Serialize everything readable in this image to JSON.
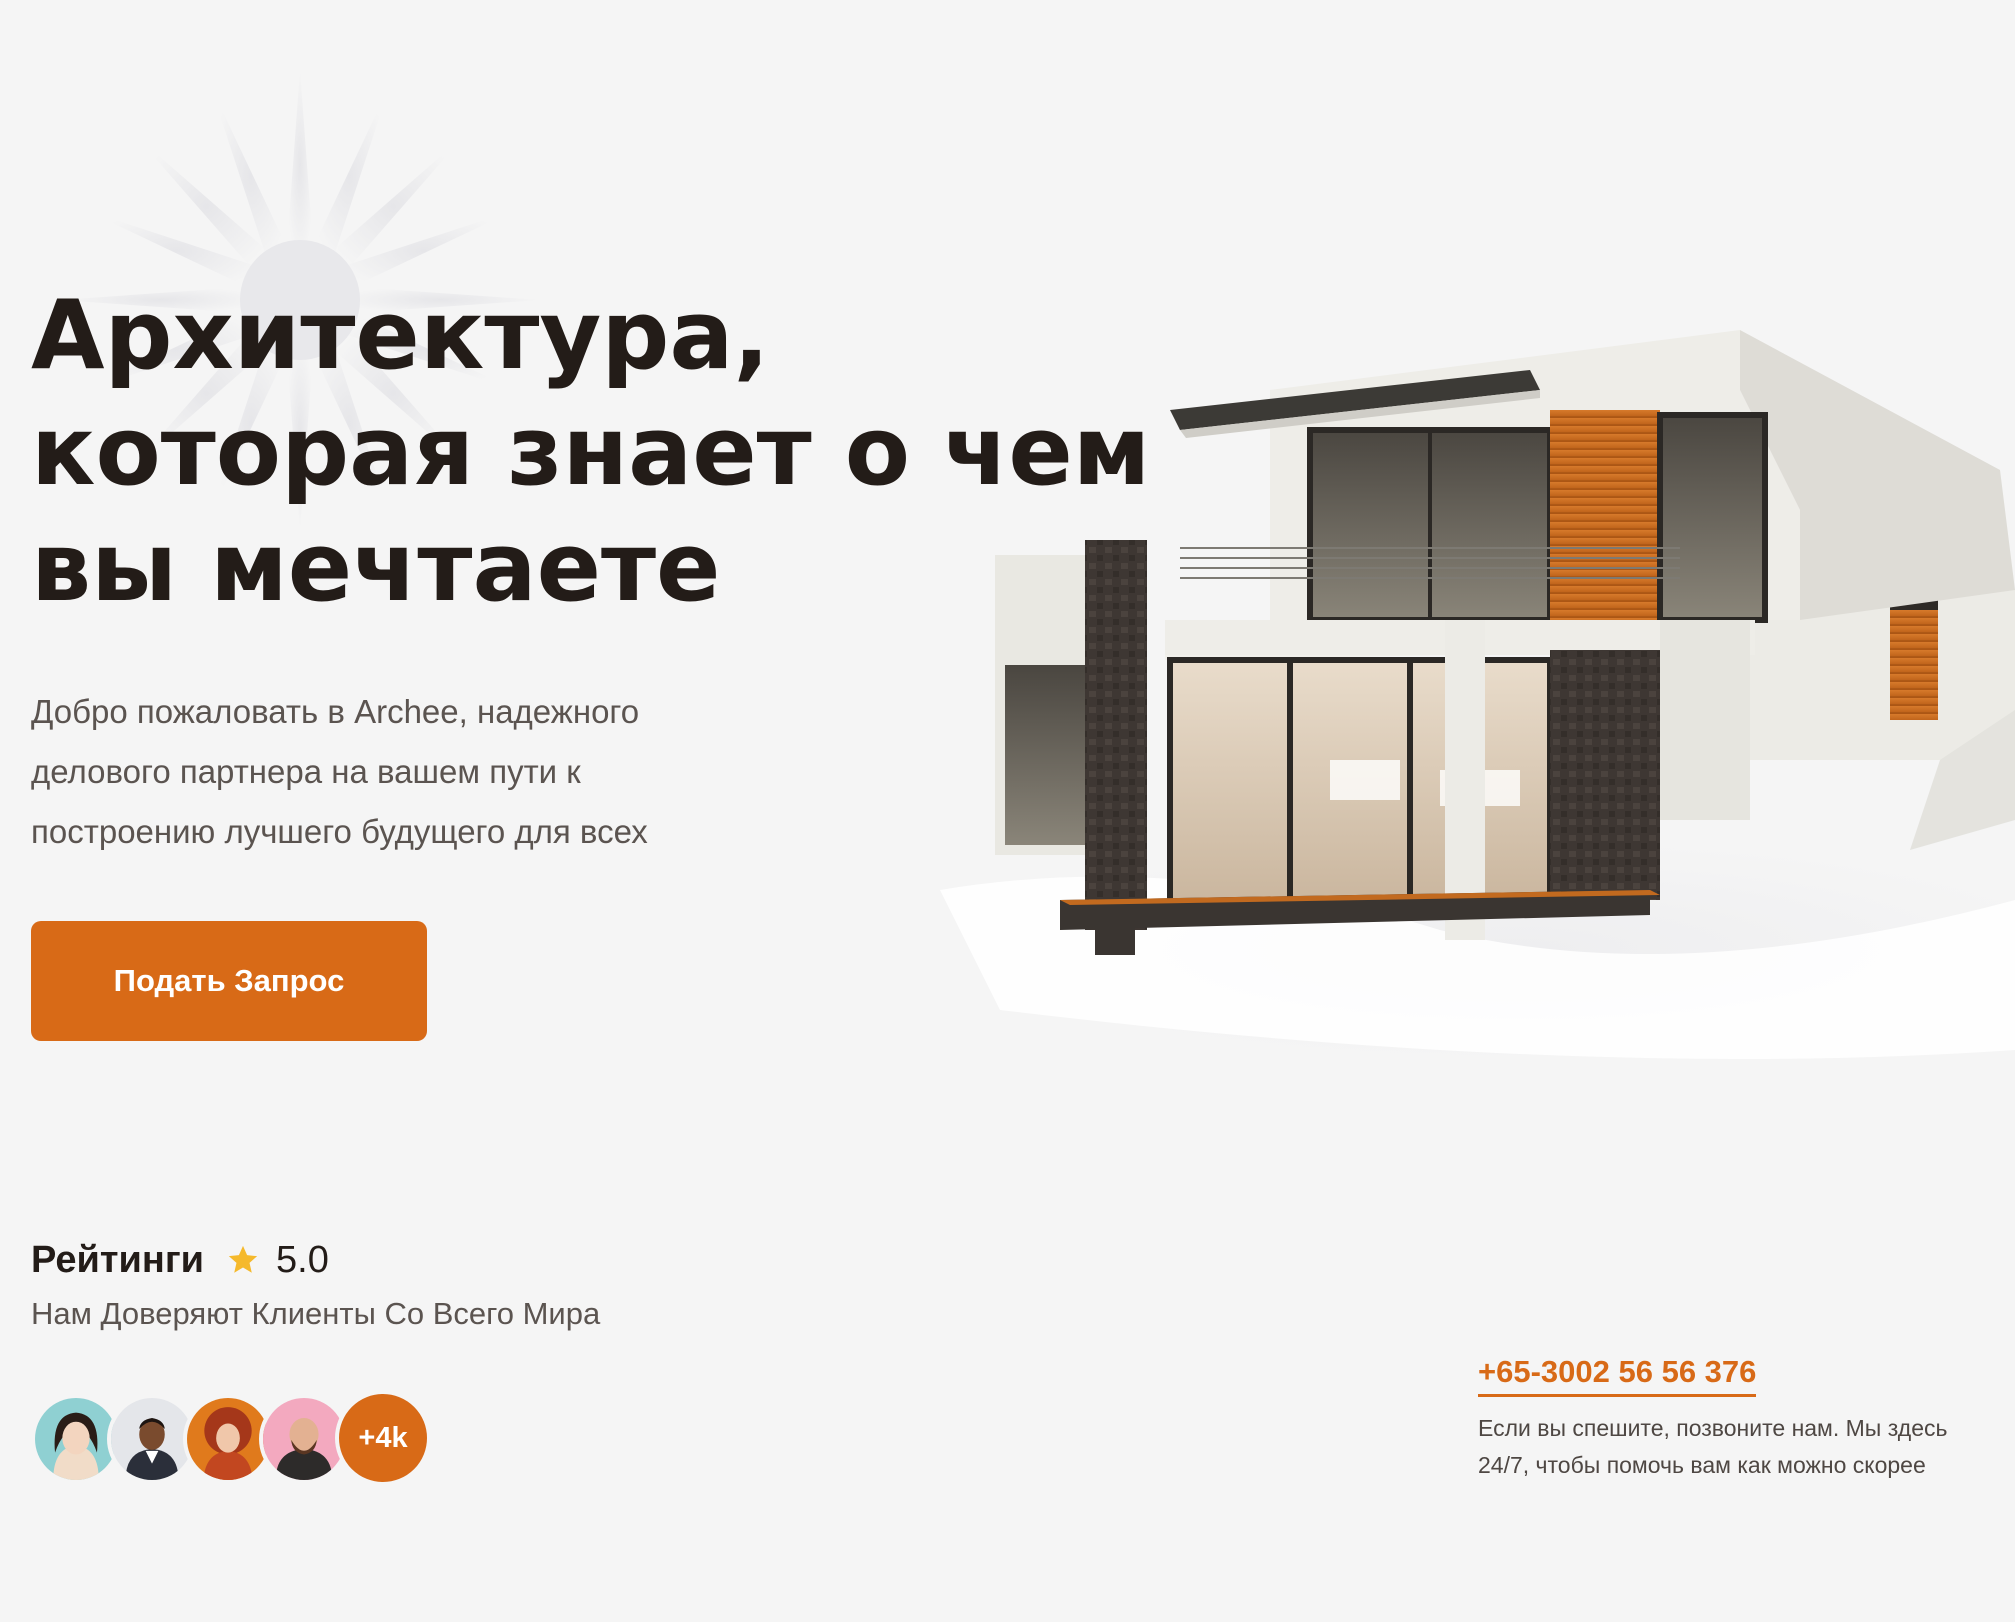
{
  "hero": {
    "headline_lines": [
      "Архитектура,",
      "которая знает о чем",
      "вы мечтаете"
    ],
    "intro_lines": [
      "Добро пожаловать в Archee, надежного",
      "делового партнера на вашем пути к",
      "построению лучшего будущего для всех"
    ],
    "cta_label": "Подать Запрос",
    "image_icon": "modern-house-illustration"
  },
  "rating": {
    "label": "Рейтинги",
    "icon": "star-icon",
    "value": "5.0",
    "subtitle": "Нам Доверяют Клиенты Со Всего Мира",
    "more_count": "+4k"
  },
  "contact": {
    "phone": "+65-3002 56 56 376",
    "note_lines": [
      "Если вы спешите, позвоните нам. Мы здесь",
      "24/7, чтобы помочь вам как можно скорее"
    ]
  },
  "colors": {
    "accent": "#d86a17",
    "heading": "#231c18",
    "body_text": "#5b5450",
    "background": "#f5f5f5"
  }
}
